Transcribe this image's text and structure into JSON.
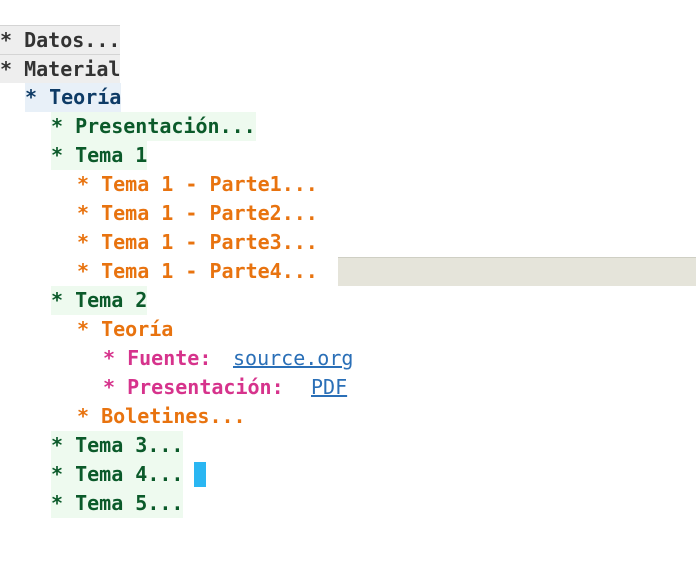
{
  "outline": {
    "datos": "* Datos...",
    "material": "* Material",
    "teoria_1": "* Teoría",
    "presentacion_1": "* Presentación...",
    "tema_1": "* Tema 1",
    "tema_1_parte1": "* Tema 1 - Parte1...",
    "tema_1_parte2": "* Tema 1 - Parte2...",
    "tema_1_parte3": "* Tema 1 - Parte3...",
    "tema_1_parte4": "* Tema 1 - Parte4...",
    "tema_2": "* Tema 2",
    "teoria_2": "* Teoría",
    "fuente_label": "* Fuente:",
    "fuente_link": "source.org",
    "presentacion_2_label": "* Presentación:",
    "presentacion_2_link": "PDF",
    "boletines": "* Boletines...",
    "tema_3": "* Tema 3...",
    "tema_4": "* Tema 4...",
    "tema_5": "* Tema 5..."
  },
  "colors": {
    "level1": "#333333",
    "level2": "#0e3b66",
    "level3": "#0b5a2a",
    "level4": "#e8730f",
    "level5": "#d6338c",
    "link": "#2a6fb7",
    "cursor": "#2ab6f2"
  }
}
